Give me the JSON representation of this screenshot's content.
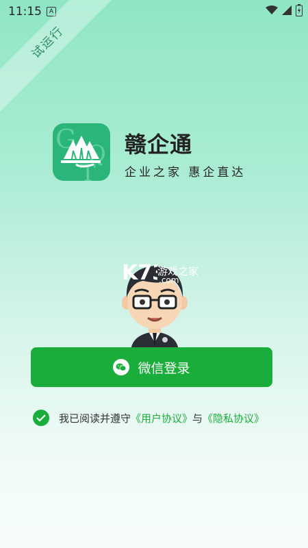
{
  "status": {
    "time": "11:15",
    "notification_letter": "A"
  },
  "ribbon": {
    "label": "试运行"
  },
  "app": {
    "name": "赣企通",
    "slogan": "企业之家  惠企直达"
  },
  "watermark": {
    "brand": "K73",
    "text": "游戏之家",
    "domain": ".com"
  },
  "login": {
    "button_label": "微信登录",
    "icon": "wechat-icon"
  },
  "agreement": {
    "prefix": "我已阅读并遵守",
    "user_agreement": "《用户协议》",
    "conjunction": "与",
    "privacy_agreement": "《隐私协议》",
    "checked": true
  },
  "colors": {
    "primary_green": "#1aad3b",
    "logo_green": "#2bb57b"
  }
}
